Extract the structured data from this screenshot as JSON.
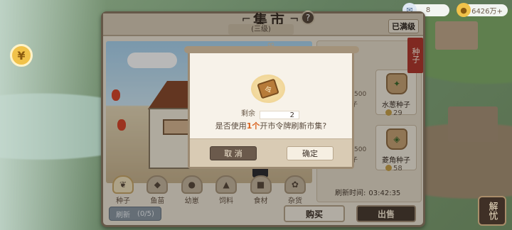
{
  "resources": {
    "tickets": "8",
    "coins": "6426万+"
  },
  "market": {
    "title": "集市",
    "level": "(三级)",
    "max_level": "已满级",
    "help_icon": "?"
  },
  "tabs": [
    {
      "label": "种子",
      "icon": "sprout-icon"
    },
    {
      "label": "鱼苗",
      "icon": "fish-icon"
    },
    {
      "label": "幼崽",
      "icon": "cub-icon"
    },
    {
      "label": "饲料",
      "icon": "feed-icon"
    },
    {
      "label": "食材",
      "icon": "ingredient-icon"
    },
    {
      "label": "杂货",
      "icon": "goods-icon"
    }
  ],
  "refresh": {
    "label": "刷新",
    "count": "(0/5)",
    "time_label": "刷新时间:",
    "time_value": "03:42:35"
  },
  "actions": {
    "buy": "购买",
    "sell": "出售"
  },
  "category_tag": "种子",
  "goods": [
    {
      "name": "水葱种子",
      "price": "29"
    },
    {
      "name": "菱角种子",
      "price": "58"
    }
  ],
  "goods_partial": {
    "name_a": "子",
    "price_a": "500",
    "name_b": "子",
    "price_b": "500"
  },
  "dialog": {
    "remain_label": "剩余",
    "remain_value": "2",
    "question_prefix": "是否使用",
    "question_highlight": "1个",
    "question_suffix": "开市令牌刷新市集?",
    "cancel": "取 消",
    "confirm": "确定"
  },
  "corner_button": "解忧",
  "colors": {
    "highlight": "#d9621e",
    "seed_tag": "#b23a2e"
  }
}
